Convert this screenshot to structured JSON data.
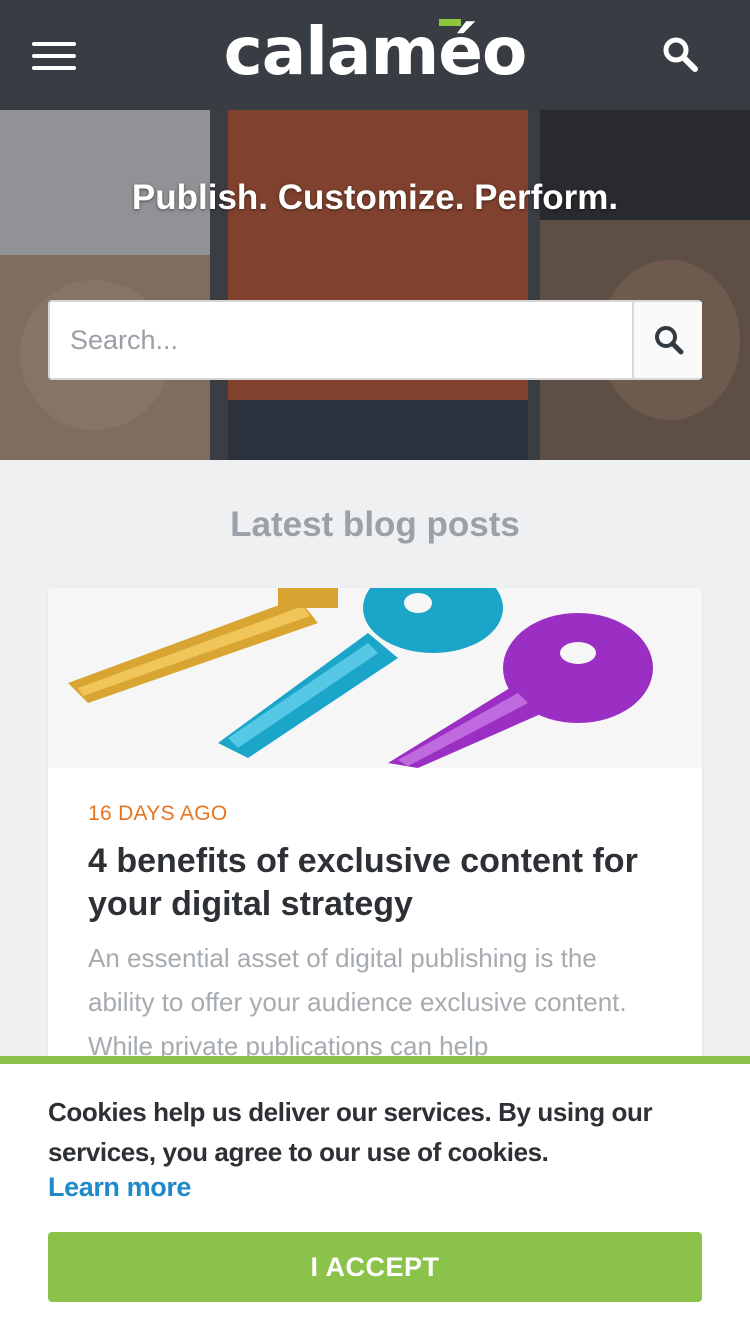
{
  "header": {
    "logo_text": "calaméo",
    "menu_icon": "hamburger-menu-icon",
    "search_icon": "search-icon",
    "accent_color": "#8fc63f"
  },
  "hero": {
    "title": "Publish. Customize. Perform.",
    "search_placeholder": "Search...",
    "search_value": "",
    "search_button_icon": "search-icon"
  },
  "blog": {
    "section_title": "Latest blog posts",
    "posts": [
      {
        "date": "16 DAYS AGO",
        "title": "4 benefits of exclusive content for your digital strategy",
        "excerpt": "An essential asset of digital publishing is the ability to offer your audience exclusive content. While private publications can help",
        "image": "colored-keys-image"
      }
    ]
  },
  "cookie_banner": {
    "text": "Cookies help us deliver our services. By using our services, you agree to our use of cookies.",
    "learn_more": "Learn more",
    "accept_label": "I ACCEPT",
    "accent_color": "#8bc34a",
    "link_color": "#1f8ac9"
  },
  "colors": {
    "header_bg": "#383d43",
    "date_color": "#e8741e",
    "page_bg": "#eff0f2"
  }
}
